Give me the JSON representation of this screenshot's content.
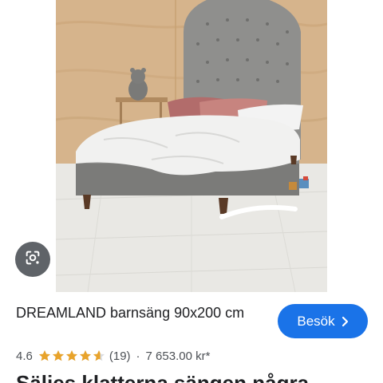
{
  "product": {
    "title": "DREAMLAND barnsäng 90x200 cm",
    "rating": "4.6",
    "stars": 4.6,
    "review_count": "(19)",
    "separator": "·",
    "price": "7 653.00 kr*",
    "visit_label": "Besök",
    "description_partial": "Säljes klatterna sängen några"
  },
  "icons": {
    "lens": "google-lens-icon",
    "visit_chevron": "chevron-right-icon",
    "star": "star-icon"
  },
  "colors": {
    "accent": "#1a73e8",
    "star": "#e8a32b",
    "lens_bg": "#5f6368",
    "text": "#202124",
    "subtext": "#4d5156"
  }
}
